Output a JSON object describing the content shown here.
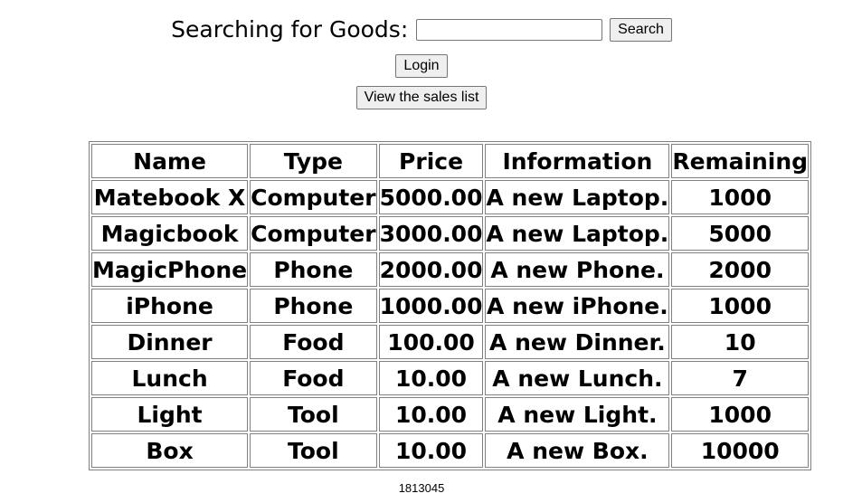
{
  "search": {
    "label": "Searching for Goods:",
    "value": "",
    "placeholder": "",
    "button": "Search"
  },
  "login_button": "Login",
  "sales_list_button": "View the sales list",
  "table": {
    "headers": [
      "Name",
      "Type",
      "Price",
      "Information",
      "Remaining"
    ],
    "rows": [
      [
        "Matebook X",
        "Computer",
        "5000.00",
        "A new Laptop.",
        "1000"
      ],
      [
        "Magicbook",
        "Computer",
        "3000.00",
        "A new Laptop.",
        "5000"
      ],
      [
        "MagicPhone",
        "Phone",
        "2000.00",
        "A new Phone.",
        "2000"
      ],
      [
        "iPhone",
        "Phone",
        "1000.00",
        "A new iPhone.",
        "1000"
      ],
      [
        "Dinner",
        "Food",
        "100.00",
        "A new Dinner.",
        "10"
      ],
      [
        "Lunch",
        "Food",
        "10.00",
        "A new Lunch.",
        "7"
      ],
      [
        "Light",
        "Tool",
        "10.00",
        "A new Light.",
        "1000"
      ],
      [
        "Box",
        "Tool",
        "10.00",
        "A new Box.",
        "10000"
      ]
    ]
  },
  "footer": "1813045"
}
